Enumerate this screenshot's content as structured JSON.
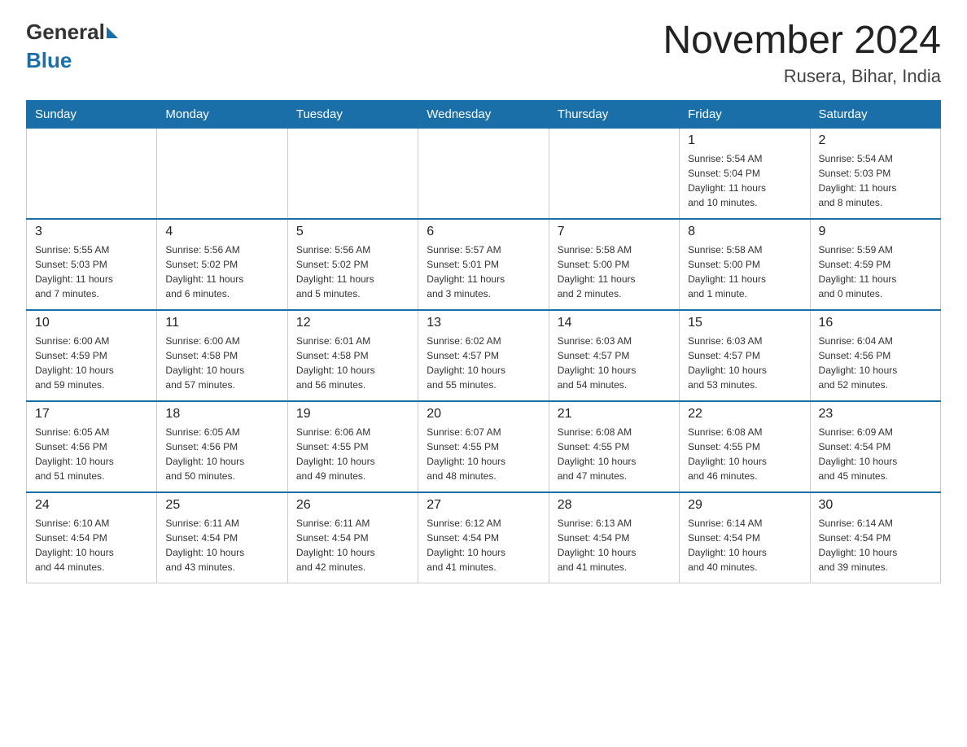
{
  "logo": {
    "text_general": "General",
    "text_blue": "Blue"
  },
  "title": "November 2024",
  "subtitle": "Rusera, Bihar, India",
  "days_of_week": [
    "Sunday",
    "Monday",
    "Tuesday",
    "Wednesday",
    "Thursday",
    "Friday",
    "Saturday"
  ],
  "weeks": [
    [
      {
        "num": "",
        "info": ""
      },
      {
        "num": "",
        "info": ""
      },
      {
        "num": "",
        "info": ""
      },
      {
        "num": "",
        "info": ""
      },
      {
        "num": "",
        "info": ""
      },
      {
        "num": "1",
        "info": "Sunrise: 5:54 AM\nSunset: 5:04 PM\nDaylight: 11 hours\nand 10 minutes."
      },
      {
        "num": "2",
        "info": "Sunrise: 5:54 AM\nSunset: 5:03 PM\nDaylight: 11 hours\nand 8 minutes."
      }
    ],
    [
      {
        "num": "3",
        "info": "Sunrise: 5:55 AM\nSunset: 5:03 PM\nDaylight: 11 hours\nand 7 minutes."
      },
      {
        "num": "4",
        "info": "Sunrise: 5:56 AM\nSunset: 5:02 PM\nDaylight: 11 hours\nand 6 minutes."
      },
      {
        "num": "5",
        "info": "Sunrise: 5:56 AM\nSunset: 5:02 PM\nDaylight: 11 hours\nand 5 minutes."
      },
      {
        "num": "6",
        "info": "Sunrise: 5:57 AM\nSunset: 5:01 PM\nDaylight: 11 hours\nand 3 minutes."
      },
      {
        "num": "7",
        "info": "Sunrise: 5:58 AM\nSunset: 5:00 PM\nDaylight: 11 hours\nand 2 minutes."
      },
      {
        "num": "8",
        "info": "Sunrise: 5:58 AM\nSunset: 5:00 PM\nDaylight: 11 hours\nand 1 minute."
      },
      {
        "num": "9",
        "info": "Sunrise: 5:59 AM\nSunset: 4:59 PM\nDaylight: 11 hours\nand 0 minutes."
      }
    ],
    [
      {
        "num": "10",
        "info": "Sunrise: 6:00 AM\nSunset: 4:59 PM\nDaylight: 10 hours\nand 59 minutes."
      },
      {
        "num": "11",
        "info": "Sunrise: 6:00 AM\nSunset: 4:58 PM\nDaylight: 10 hours\nand 57 minutes."
      },
      {
        "num": "12",
        "info": "Sunrise: 6:01 AM\nSunset: 4:58 PM\nDaylight: 10 hours\nand 56 minutes."
      },
      {
        "num": "13",
        "info": "Sunrise: 6:02 AM\nSunset: 4:57 PM\nDaylight: 10 hours\nand 55 minutes."
      },
      {
        "num": "14",
        "info": "Sunrise: 6:03 AM\nSunset: 4:57 PM\nDaylight: 10 hours\nand 54 minutes."
      },
      {
        "num": "15",
        "info": "Sunrise: 6:03 AM\nSunset: 4:57 PM\nDaylight: 10 hours\nand 53 minutes."
      },
      {
        "num": "16",
        "info": "Sunrise: 6:04 AM\nSunset: 4:56 PM\nDaylight: 10 hours\nand 52 minutes."
      }
    ],
    [
      {
        "num": "17",
        "info": "Sunrise: 6:05 AM\nSunset: 4:56 PM\nDaylight: 10 hours\nand 51 minutes."
      },
      {
        "num": "18",
        "info": "Sunrise: 6:05 AM\nSunset: 4:56 PM\nDaylight: 10 hours\nand 50 minutes."
      },
      {
        "num": "19",
        "info": "Sunrise: 6:06 AM\nSunset: 4:55 PM\nDaylight: 10 hours\nand 49 minutes."
      },
      {
        "num": "20",
        "info": "Sunrise: 6:07 AM\nSunset: 4:55 PM\nDaylight: 10 hours\nand 48 minutes."
      },
      {
        "num": "21",
        "info": "Sunrise: 6:08 AM\nSunset: 4:55 PM\nDaylight: 10 hours\nand 47 minutes."
      },
      {
        "num": "22",
        "info": "Sunrise: 6:08 AM\nSunset: 4:55 PM\nDaylight: 10 hours\nand 46 minutes."
      },
      {
        "num": "23",
        "info": "Sunrise: 6:09 AM\nSunset: 4:54 PM\nDaylight: 10 hours\nand 45 minutes."
      }
    ],
    [
      {
        "num": "24",
        "info": "Sunrise: 6:10 AM\nSunset: 4:54 PM\nDaylight: 10 hours\nand 44 minutes."
      },
      {
        "num": "25",
        "info": "Sunrise: 6:11 AM\nSunset: 4:54 PM\nDaylight: 10 hours\nand 43 minutes."
      },
      {
        "num": "26",
        "info": "Sunrise: 6:11 AM\nSunset: 4:54 PM\nDaylight: 10 hours\nand 42 minutes."
      },
      {
        "num": "27",
        "info": "Sunrise: 6:12 AM\nSunset: 4:54 PM\nDaylight: 10 hours\nand 41 minutes."
      },
      {
        "num": "28",
        "info": "Sunrise: 6:13 AM\nSunset: 4:54 PM\nDaylight: 10 hours\nand 41 minutes."
      },
      {
        "num": "29",
        "info": "Sunrise: 6:14 AM\nSunset: 4:54 PM\nDaylight: 10 hours\nand 40 minutes."
      },
      {
        "num": "30",
        "info": "Sunrise: 6:14 AM\nSunset: 4:54 PM\nDaylight: 10 hours\nand 39 minutes."
      }
    ]
  ]
}
